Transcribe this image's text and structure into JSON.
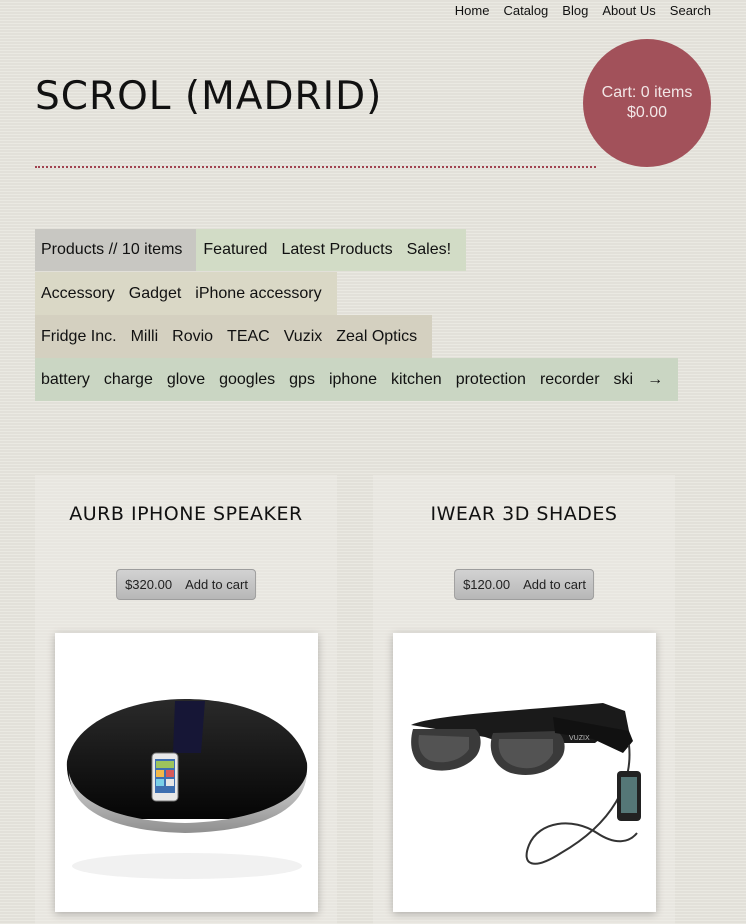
{
  "nav": {
    "home": "Home",
    "catalog": "Catalog",
    "blog": "Blog",
    "about": "About Us",
    "search": "Search"
  },
  "site": {
    "title": "SCROL (MADRID)"
  },
  "cart": {
    "items": "Cart: 0 items",
    "total": "$0.00"
  },
  "filters": {
    "row1": {
      "label": "Products // 10 items",
      "items": [
        "Featured",
        "Latest Products",
        "Sales!"
      ]
    },
    "row2": [
      "Accessory",
      "Gadget",
      "iPhone accessory"
    ],
    "row3": [
      "Fridge Inc.",
      "Milli",
      "Rovio",
      "TEAC",
      "Vuzix",
      "Zeal Optics"
    ],
    "row4": [
      "battery",
      "charge",
      "glove",
      "googles",
      "gps",
      "iphone",
      "kitchen",
      "protection",
      "recorder",
      "ski",
      "→"
    ]
  },
  "products": [
    {
      "name": "AURB IPHONE SPEAKER",
      "price": "$320.00",
      "add": "Add to cart"
    },
    {
      "name": "IWEAR 3D SHADES",
      "price": "$120.00",
      "add": "Add to cart"
    }
  ],
  "colors": {
    "accent": "#a2515a",
    "rule": "#a0424f"
  }
}
